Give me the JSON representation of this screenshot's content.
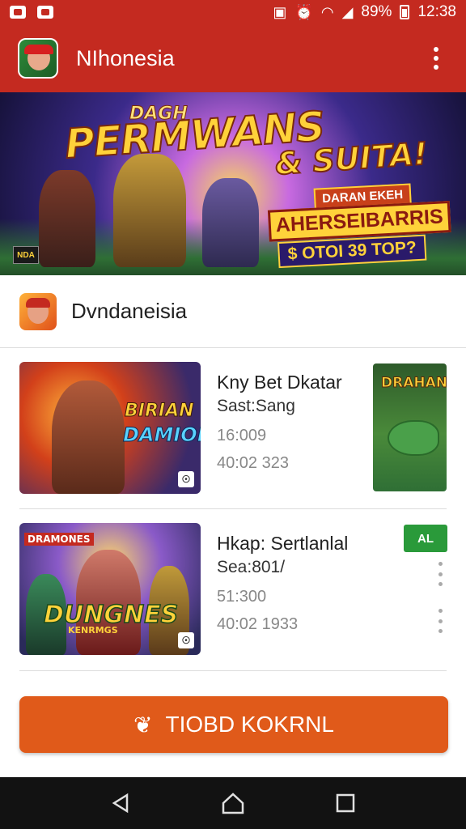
{
  "status_bar": {
    "battery": "89%",
    "time": "12:38"
  },
  "app_bar": {
    "title": "NIhonesia"
  },
  "hero": {
    "pretitle": "DAGH",
    "title": "PERMWANS",
    "suffix": "& SUITA!",
    "sub1": "DARAN EKEH",
    "sub2": "AHERSEIBARRIS",
    "sub3": "$ OTOI 39 TOP?",
    "corner_logo": "NDA"
  },
  "section": {
    "title": "Dvndaneisia"
  },
  "items": [
    {
      "thumb_text_a": "BIRIAN",
      "thumb_text_b": "DAMION",
      "title": "Kny Bet Dkatar",
      "subtitle": "Sast:Sang",
      "stat1": "16:009",
      "stat2": "40:02 323",
      "side_title": "DRAHAN"
    },
    {
      "thumb_top": "DRAMONES",
      "thumb_text_a": "DUNGNES",
      "thumb_text_b": "KENRMGS",
      "title": "Hkap: Sertlanlal",
      "subtitle": "Sea:801/",
      "stat1": "51:300",
      "stat2": "40:02 1933",
      "install_badge": "AL"
    }
  ],
  "action": {
    "label": "TIOBD KOKRNL"
  }
}
